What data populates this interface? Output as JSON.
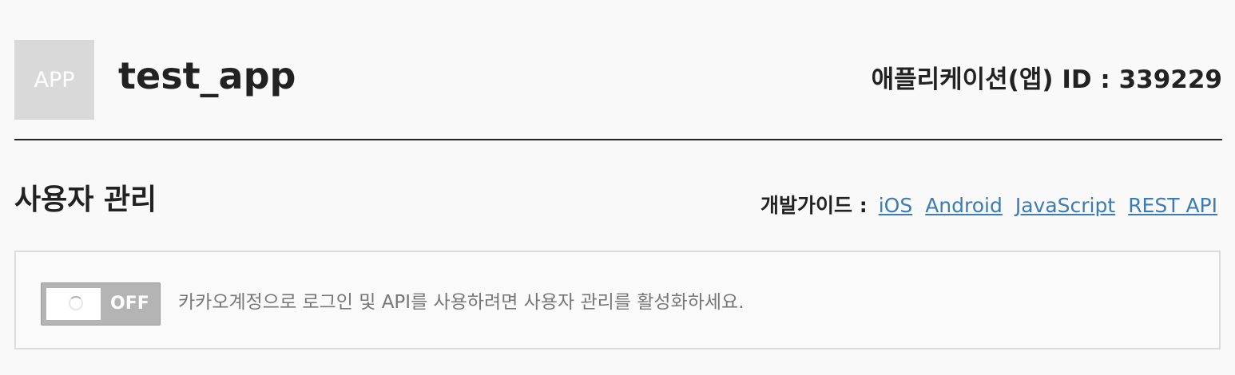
{
  "app": {
    "icon_text": "APP",
    "name": "test_app",
    "id_text": "애플리케이션(앱) ID : 339229"
  },
  "section": {
    "title": "사용자 관리"
  },
  "guide": {
    "label": "개발가이드 :",
    "links": [
      "iOS",
      "Android",
      "JavaScript",
      "REST API"
    ]
  },
  "toggle": {
    "state_label": "OFF"
  },
  "panel": {
    "message": "카카오계정으로 로그인 및 API를 사용하려면 사용자 관리를 활성화하세요."
  },
  "colors": {
    "link": "#3b7cb5",
    "toggle_off": "#b4b4b4",
    "app_icon_bg": "#d9d9d9"
  }
}
